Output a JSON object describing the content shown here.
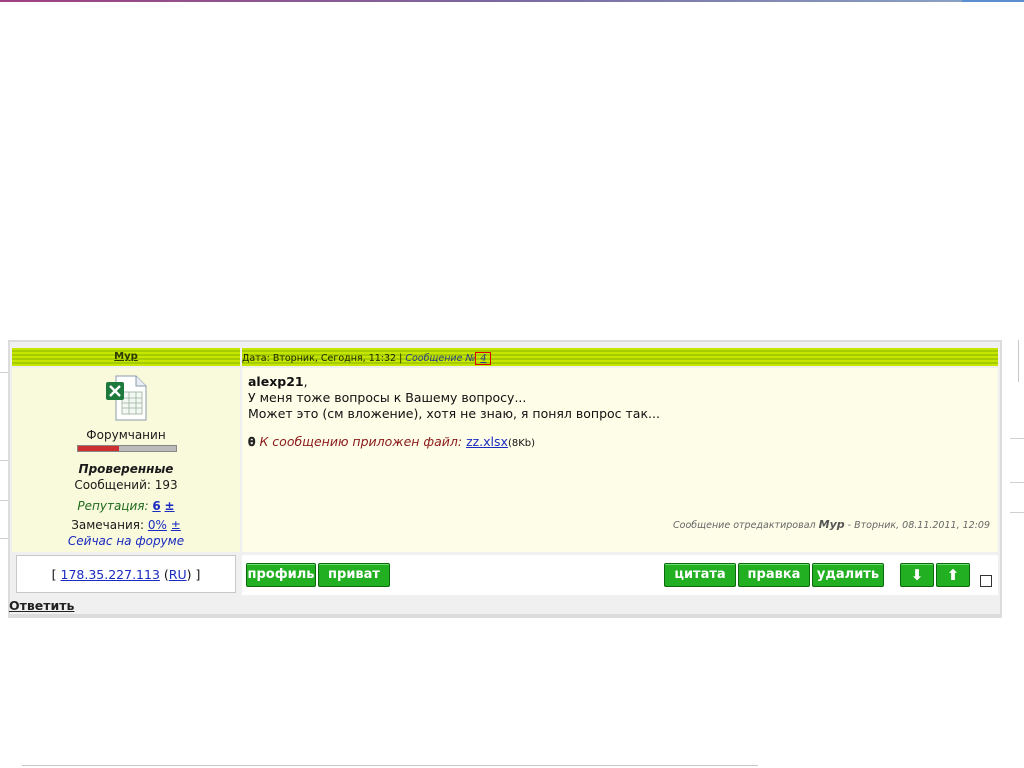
{
  "post": {
    "author": "Мур",
    "header": {
      "date_prefix": "Дата: Вторник, Сегодня, 11:32 | ",
      "message_label": "Сообщение №",
      "message_number": "4"
    },
    "profile": {
      "avatar_icon": "excel-file-icon",
      "rank": "Форумчанин",
      "rank_progress_percent": 42,
      "group": "Проверенные",
      "posts_count": "Сообщений: 193",
      "reputation_label": "Репутация:",
      "reputation_value": "6",
      "reputation_plusminus": "±",
      "warnings_label": "Замечания:",
      "warnings_value": "0%",
      "warnings_plusminus": "±",
      "status": "Сейчас на форуме"
    },
    "message": {
      "addressee": "alexp21",
      "lines": [
        "У меня тоже вопросы к Вашему вопросу...",
        "Может это (см вложение), хотя не знаю, я понял вопрос так..."
      ],
      "attachment_text": "К сообщению приложен файл:",
      "attachment_file": "zz.xlsx",
      "attachment_size": "(8Kb)"
    },
    "edited": {
      "prefix": "Сообщение отредактировал",
      "editor": "Мур",
      "suffix": "- Вторник, 08.11.2011, 12:09"
    },
    "footer": {
      "ip_open": "[ ",
      "ip": "178.35.227.113",
      "country": "RU",
      "ip_close": " ]"
    },
    "buttons": {
      "profile": "профиль",
      "private": "приват",
      "quote": "цитата",
      "edit": "правка",
      "delete": "удалить"
    }
  },
  "reply_link": "Ответить"
}
